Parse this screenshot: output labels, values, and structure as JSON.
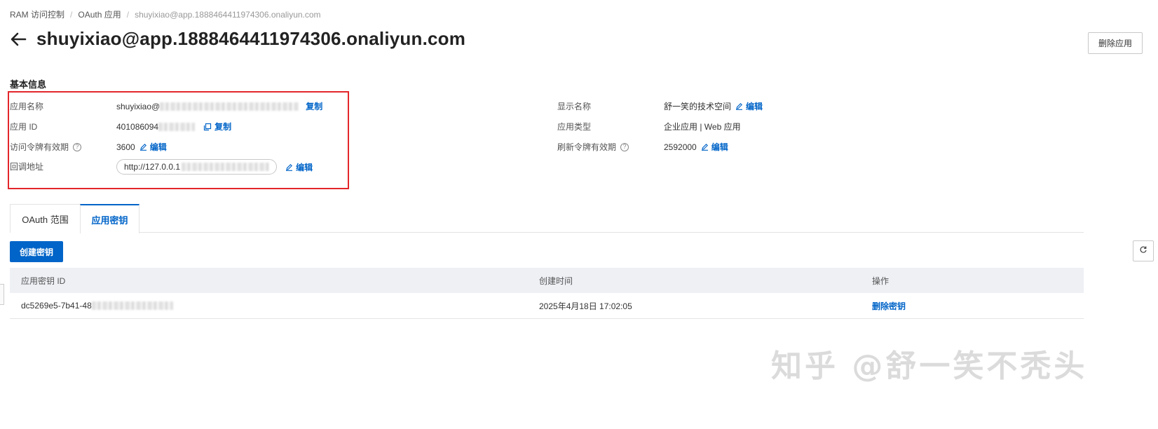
{
  "breadcrumb": {
    "items": [
      "RAM 访问控制",
      "OAuth 应用",
      "shuyixiao@app.1888464411974306.onaliyun.com"
    ],
    "separator": "/"
  },
  "header": {
    "title": "shuyixiao@app.1888464411974306.onaliyun.com",
    "delete_app_label": "删除应用"
  },
  "basic_info": {
    "section_title": "基本信息",
    "left": {
      "app_name_label": "应用名称",
      "app_name_value": "shuyixiao@",
      "copy_label": "复制",
      "app_id_label": "应用 ID",
      "app_id_value": "401086094",
      "token_validity_label": "访问令牌有效期",
      "token_validity_value": "3600",
      "edit_label": "编辑",
      "callback_label": "回调地址",
      "callback_value": "http://127.0.0.1"
    },
    "right": {
      "display_name_label": "显示名称",
      "display_name_value": "舒一笑的技术空间",
      "app_type_label": "应用类型",
      "app_type_value": "企业应用 | Web 应用",
      "refresh_validity_label": "刷新令牌有效期",
      "refresh_validity_value": "2592000"
    }
  },
  "tabs": [
    {
      "label": "OAuth 范围",
      "active": false
    },
    {
      "label": "应用密钥",
      "active": true
    }
  ],
  "toolbar": {
    "create_key_label": "创建密钥"
  },
  "table": {
    "headers": [
      "应用密钥 ID",
      "创建时间",
      "操作"
    ],
    "rows": [
      {
        "key_id": "dc5269e5-7b41-48",
        "created": "2025年4月18日 17:02:05",
        "action": "删除密钥"
      }
    ]
  },
  "watermark": "知乎 @舒一笑不秃头",
  "colors": {
    "accent": "#0064c8",
    "highlight": "#e3262b"
  }
}
